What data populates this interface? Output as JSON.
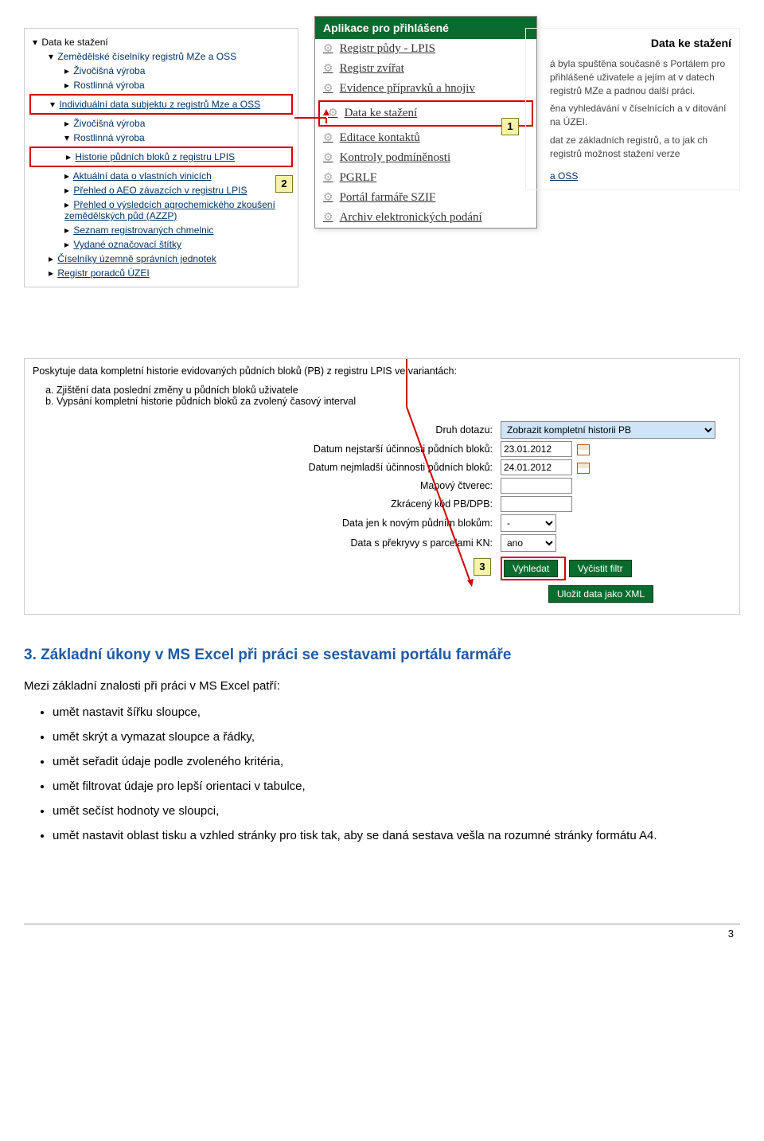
{
  "left_panel": {
    "items": [
      {
        "label": "Data ke stažení",
        "cls": "indent0 sel"
      },
      {
        "label": "Zemědělské číselníky registrů MZe a OSS",
        "cls": "indent1"
      },
      {
        "label": "Živočišná výroba",
        "cls": "indent2"
      },
      {
        "label": "Rostlinná výroba",
        "cls": "indent2"
      },
      {
        "label": "Individuální data subjektu z registrů Mze a OSS",
        "cls": "indent1 underline boxed"
      },
      {
        "label": "Živočišná výroba",
        "cls": "indent2"
      },
      {
        "label": "Rostlinná výroba",
        "cls": "indent2"
      },
      {
        "label": "Historie půdních bloků z registru LPIS",
        "cls": "indent2 underline boxed2"
      },
      {
        "label": "Aktuální data o vlastních vinicích",
        "cls": "indent2 underline"
      },
      {
        "label": "Přehled o AEO závazcích v registru LPIS",
        "cls": "indent2 underline"
      },
      {
        "label": "Přehled o výsledcích agrochemického zkoušení zemědělských půd (AZZP)",
        "cls": "indent2 underline"
      },
      {
        "label": "Seznam registrovaných chmelnic",
        "cls": "indent2 underline"
      },
      {
        "label": "Vydané označovací štítky",
        "cls": "indent2 underline"
      },
      {
        "label": "Číselníky územně správních jednotek",
        "cls": "indent1 underline"
      },
      {
        "label": "Registr poradců ÚZEI",
        "cls": "indent1 underline"
      }
    ]
  },
  "popup": {
    "title": "Aplikace pro přihlášené",
    "items": [
      "Registr půdy - LPIS",
      "Registr zvířat",
      "Evidence přípravků a hnojiv",
      "Data ke stažení",
      "Editace kontaktů",
      "Kontroly podmíněnosti",
      "PGRLF",
      "Portál farmáře SZIF",
      "Archiv elektronických podání"
    ],
    "highlight_index": 3
  },
  "right_panel": {
    "title": "Data ke stažení",
    "p1": "á byla spuštěna současně s Portálem pro přihlášené uživatele a jejím at v datech registrů MZe a padnou další práci.",
    "p2": "ěna vyhledávání v číselnících a v ditování na ÚZEI.",
    "p3": "dat ze základních registrů, a to jak ch registrů možnost stažení verze",
    "link": "a OSS"
  },
  "main": {
    "intro": "Poskytuje data kompletní historie evidovaných půdních bloků (PB) z registru LPIS ve variantách:",
    "li1": "Zjištění data poslední změny u půdních bloků uživatele",
    "li2": "Vypsání kompletní historie půdních bloků za zvolený časový interval",
    "form": {
      "l1": "Druh dotazu:",
      "v1": "Zobrazit kompletní historii PB",
      "l2": "Datum nejstarší účinnosti půdních bloků:",
      "v2": "23.01.2012",
      "l3": "Datum nejmladší účinnosti půdních bloků:",
      "v3": "24.01.2012",
      "l4": "Mapový čtverec:",
      "v4": "",
      "l5": "Zkrácený kód PB/DPB:",
      "v5": "",
      "l6": "Data jen k novým půdním blokům:",
      "v6": "-",
      "l7": "Data s překryvy s parcelami KN:",
      "v7": "ano"
    },
    "buttons": {
      "search": "Vyhledat",
      "clear": "Vyčistit filtr",
      "xml": "Uložit data jako XML"
    }
  },
  "callouts": {
    "n1": "1",
    "n2": "2",
    "n3": "3"
  },
  "text": {
    "heading": "3. Základní úkony v MS Excel při práci se sestavami portálu farmáře",
    "para": "Mezi základní znalosti při práci v MS Excel patří:",
    "bullets": [
      "umět nastavit šířku sloupce,",
      "umět skrýt  a vymazat sloupce a řádky,",
      "umět seřadit údaje podle zvoleného kritéria,",
      "umět filtrovat údaje pro lepší orientaci v tabulce,",
      "umět sečíst hodnoty ve sloupci,",
      "umět nastavit oblast tisku a vzhled stránky pro tisk tak, aby se daná sestava vešla na rozumné stránky formátu A4."
    ]
  },
  "page_number": "3"
}
